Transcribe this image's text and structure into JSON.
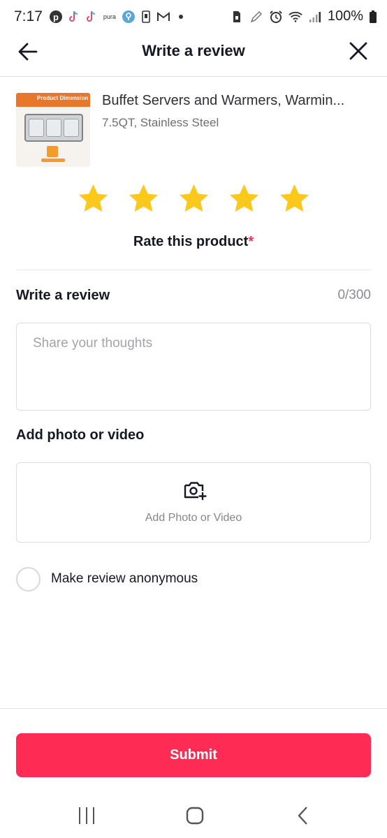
{
  "status_bar": {
    "time": "7:17",
    "notification_icons": [
      "pinterest-icon",
      "tiktok-icon",
      "tiktok-icon",
      "pura-icon",
      "location-icon",
      "phone-icon",
      "gmail-icon",
      "dot-icon"
    ],
    "pura_text": "pura",
    "right_icons": [
      "sim-icon",
      "pen-icon",
      "alarm-icon",
      "wifi-icon",
      "signal-icon",
      "battery-icon"
    ],
    "battery": "100%"
  },
  "header": {
    "title": "Write a review"
  },
  "product": {
    "title": "Buffet Servers and Warmers, Warmin...",
    "variant": "7.5QT, Stainless Steel",
    "thumb_banner": "Product Dimension"
  },
  "rating": {
    "stars": 5,
    "max": 5,
    "label": "Rate this product",
    "required_mark": "*",
    "star_color": "#fcc81c"
  },
  "review": {
    "title": "Write a review",
    "count": "0/300",
    "value": "",
    "placeholder": "Share your thoughts"
  },
  "media": {
    "title": "Add photo or video",
    "button_label": "Add Photo or Video"
  },
  "anonymous": {
    "label": "Make review anonymous",
    "checked": false
  },
  "submit": {
    "label": "Submit",
    "color": "#fe2c55"
  },
  "nav": {
    "items": [
      "recent-apps-icon",
      "home-icon",
      "back-icon"
    ]
  }
}
